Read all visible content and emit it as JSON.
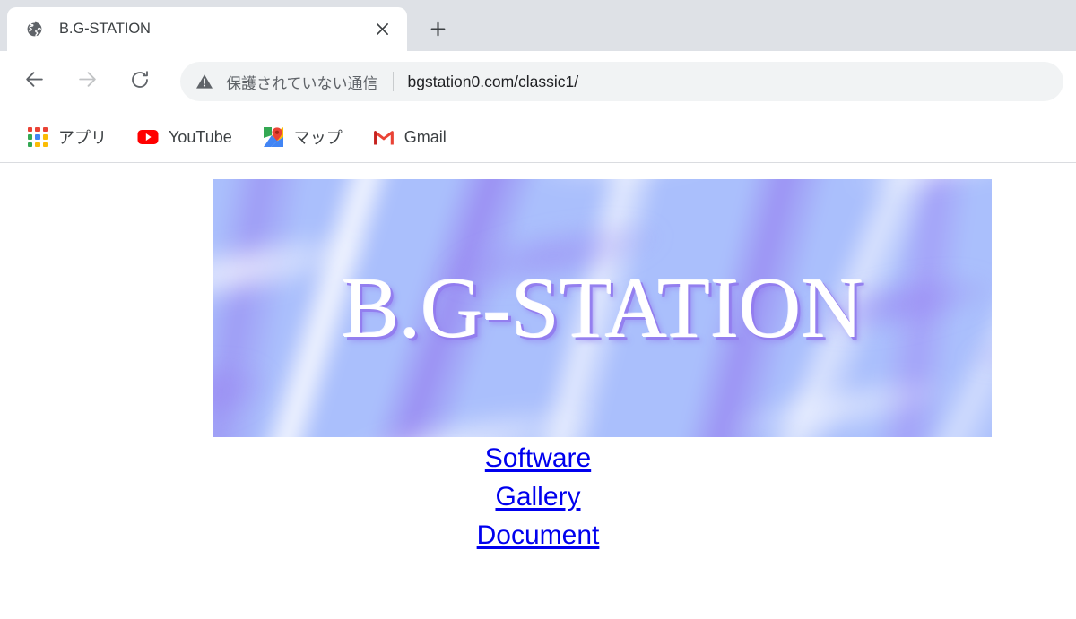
{
  "browser": {
    "tab": {
      "favicon": "globe-icon",
      "title": "B.G-STATION",
      "close_label": "×"
    },
    "newtab_label": "+",
    "toolbar": {
      "back_label": "←",
      "forward_label": "→",
      "reload_label": "↻",
      "security_icon": "warning-triangle-icon",
      "security_text": "保護されていない通信",
      "url": "bgstation0.com/classic1/"
    },
    "bookmarks": [
      {
        "icon": "apps-grid-icon",
        "label": "アプリ"
      },
      {
        "icon": "youtube-icon",
        "label": "YouTube"
      },
      {
        "icon": "google-maps-icon",
        "label": "マップ"
      },
      {
        "icon": "gmail-icon",
        "label": "Gmail"
      }
    ]
  },
  "page": {
    "banner": {
      "title": "B.G-STATION",
      "base_color": "#aabffc",
      "streak_color": "#9882f2",
      "text_color": "#ffffff",
      "shadow_color": "#927cee"
    },
    "links": [
      {
        "label": "Software"
      },
      {
        "label": "Gallery"
      },
      {
        "label": "Document"
      }
    ],
    "link_color": "#0000ee"
  },
  "apps_icon_colors": [
    "#ea4335",
    "#ea4335",
    "#ea4335",
    "#34a853",
    "#4285f4",
    "#fbbc05",
    "#34a853",
    "#fbbc05",
    "#fbbc05"
  ]
}
